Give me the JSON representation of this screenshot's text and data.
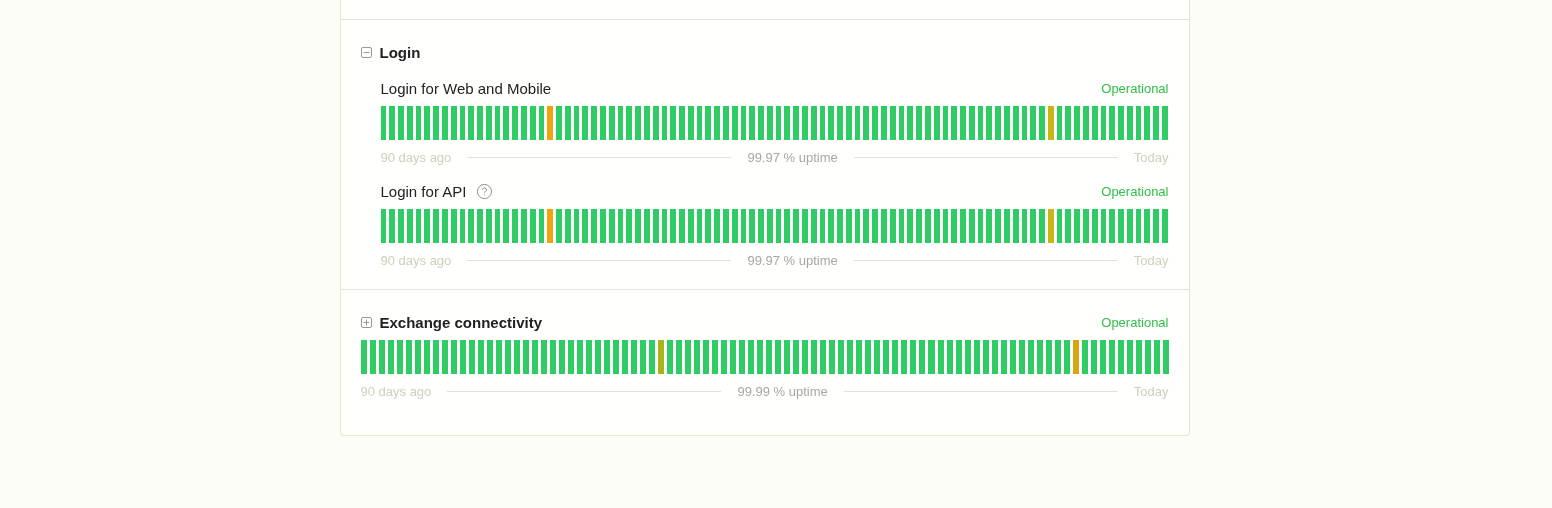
{
  "groups": [
    {
      "name": "Login",
      "expanded": true,
      "components": [
        {
          "name": "Login for Web and Mobile",
          "help": false,
          "status": "Operational",
          "start_label": "90 days ago",
          "uptime": "99.97 % uptime",
          "end_label": "Today",
          "days": [
            {
              "color": "#2fcc66"
            },
            {
              "color": "#2fcc66"
            },
            {
              "color": "#2fcc66"
            },
            {
              "color": "#2fcc66"
            },
            {
              "color": "#2fcc66"
            },
            {
              "color": "#2fcc66"
            },
            {
              "color": "#2fcc66"
            },
            {
              "color": "#2fcc66"
            },
            {
              "color": "#2fcc66"
            },
            {
              "color": "#2fcc66"
            },
            {
              "color": "#2fcc66"
            },
            {
              "color": "#2fcc66"
            },
            {
              "color": "#2fcc66"
            },
            {
              "color": "#2fcc66"
            },
            {
              "color": "#2fcc66"
            },
            {
              "color": "#2fcc66"
            },
            {
              "color": "#2fcc66"
            },
            {
              "color": "#2fcc66"
            },
            {
              "color": "#2fcc66"
            },
            {
              "color": "#f0a30a"
            },
            {
              "color": "#2fcc66"
            },
            {
              "color": "#2fcc66"
            },
            {
              "color": "#2fcc66"
            },
            {
              "color": "#2fcc66"
            },
            {
              "color": "#2fcc66"
            },
            {
              "color": "#2fcc66"
            },
            {
              "color": "#2fcc66"
            },
            {
              "color": "#2fcc66"
            },
            {
              "color": "#2fcc66"
            },
            {
              "color": "#2fcc66"
            },
            {
              "color": "#2fcc66"
            },
            {
              "color": "#2fcc66"
            },
            {
              "color": "#2fcc66"
            },
            {
              "color": "#2fcc66"
            },
            {
              "color": "#2fcc66"
            },
            {
              "color": "#2fcc66"
            },
            {
              "color": "#2fcc66"
            },
            {
              "color": "#2fcc66"
            },
            {
              "color": "#2fcc66"
            },
            {
              "color": "#2fcc66"
            },
            {
              "color": "#2fcc66"
            },
            {
              "color": "#2fcc66"
            },
            {
              "color": "#2fcc66"
            },
            {
              "color": "#2fcc66"
            },
            {
              "color": "#2fcc66"
            },
            {
              "color": "#2fcc66"
            },
            {
              "color": "#2fcc66"
            },
            {
              "color": "#2fcc66"
            },
            {
              "color": "#2fcc66"
            },
            {
              "color": "#2fcc66"
            },
            {
              "color": "#2fcc66"
            },
            {
              "color": "#2fcc66"
            },
            {
              "color": "#2fcc66"
            },
            {
              "color": "#2fcc66"
            },
            {
              "color": "#2fcc66"
            },
            {
              "color": "#2fcc66"
            },
            {
              "color": "#2fcc66"
            },
            {
              "color": "#2fcc66"
            },
            {
              "color": "#2fcc66"
            },
            {
              "color": "#2fcc66"
            },
            {
              "color": "#2fcc66"
            },
            {
              "color": "#2fcc66"
            },
            {
              "color": "#2fcc66"
            },
            {
              "color": "#2fcc66"
            },
            {
              "color": "#2fcc66"
            },
            {
              "color": "#2fcc66"
            },
            {
              "color": "#2fcc66"
            },
            {
              "color": "#2fcc66"
            },
            {
              "color": "#2fcc66"
            },
            {
              "color": "#2fcc66"
            },
            {
              "color": "#2fcc66"
            },
            {
              "color": "#2fcc66"
            },
            {
              "color": "#2fcc66"
            },
            {
              "color": "#2fcc66"
            },
            {
              "color": "#2fcc66"
            },
            {
              "color": "#2fcc66"
            },
            {
              "color": "#c9b516"
            },
            {
              "color": "#2fcc66"
            },
            {
              "color": "#2fcc66"
            },
            {
              "color": "#2fcc66"
            },
            {
              "color": "#2fcc66"
            },
            {
              "color": "#2fcc66"
            },
            {
              "color": "#2fcc66"
            },
            {
              "color": "#2fcc66"
            },
            {
              "color": "#2fcc66"
            },
            {
              "color": "#2fcc66"
            },
            {
              "color": "#2fcc66"
            },
            {
              "color": "#2fcc66"
            },
            {
              "color": "#2fcc66"
            },
            {
              "color": "#2fcc66"
            }
          ]
        },
        {
          "name": "Login for API",
          "help": true,
          "status": "Operational",
          "start_label": "90 days ago",
          "uptime": "99.97 % uptime",
          "end_label": "Today",
          "days": [
            {
              "color": "#2fcc66"
            },
            {
              "color": "#2fcc66"
            },
            {
              "color": "#2fcc66"
            },
            {
              "color": "#2fcc66"
            },
            {
              "color": "#2fcc66"
            },
            {
              "color": "#2fcc66"
            },
            {
              "color": "#2fcc66"
            },
            {
              "color": "#2fcc66"
            },
            {
              "color": "#2fcc66"
            },
            {
              "color": "#2fcc66"
            },
            {
              "color": "#2fcc66"
            },
            {
              "color": "#2fcc66"
            },
            {
              "color": "#2fcc66"
            },
            {
              "color": "#2fcc66"
            },
            {
              "color": "#2fcc66"
            },
            {
              "color": "#2fcc66"
            },
            {
              "color": "#2fcc66"
            },
            {
              "color": "#2fcc66"
            },
            {
              "color": "#2fcc66"
            },
            {
              "color": "#f0a30a"
            },
            {
              "color": "#2fcc66"
            },
            {
              "color": "#2fcc66"
            },
            {
              "color": "#2fcc66"
            },
            {
              "color": "#2fcc66"
            },
            {
              "color": "#2fcc66"
            },
            {
              "color": "#2fcc66"
            },
            {
              "color": "#2fcc66"
            },
            {
              "color": "#2fcc66"
            },
            {
              "color": "#2fcc66"
            },
            {
              "color": "#2fcc66"
            },
            {
              "color": "#2fcc66"
            },
            {
              "color": "#2fcc66"
            },
            {
              "color": "#2fcc66"
            },
            {
              "color": "#2fcc66"
            },
            {
              "color": "#2fcc66"
            },
            {
              "color": "#2fcc66"
            },
            {
              "color": "#2fcc66"
            },
            {
              "color": "#2fcc66"
            },
            {
              "color": "#2fcc66"
            },
            {
              "color": "#2fcc66"
            },
            {
              "color": "#2fcc66"
            },
            {
              "color": "#2fcc66"
            },
            {
              "color": "#2fcc66"
            },
            {
              "color": "#2fcc66"
            },
            {
              "color": "#2fcc66"
            },
            {
              "color": "#2fcc66"
            },
            {
              "color": "#2fcc66"
            },
            {
              "color": "#2fcc66"
            },
            {
              "color": "#2fcc66"
            },
            {
              "color": "#2fcc66"
            },
            {
              "color": "#2fcc66"
            },
            {
              "color": "#2fcc66"
            },
            {
              "color": "#2fcc66"
            },
            {
              "color": "#2fcc66"
            },
            {
              "color": "#2fcc66"
            },
            {
              "color": "#2fcc66"
            },
            {
              "color": "#2fcc66"
            },
            {
              "color": "#2fcc66"
            },
            {
              "color": "#2fcc66"
            },
            {
              "color": "#2fcc66"
            },
            {
              "color": "#2fcc66"
            },
            {
              "color": "#2fcc66"
            },
            {
              "color": "#2fcc66"
            },
            {
              "color": "#2fcc66"
            },
            {
              "color": "#2fcc66"
            },
            {
              "color": "#2fcc66"
            },
            {
              "color": "#2fcc66"
            },
            {
              "color": "#2fcc66"
            },
            {
              "color": "#2fcc66"
            },
            {
              "color": "#2fcc66"
            },
            {
              "color": "#2fcc66"
            },
            {
              "color": "#2fcc66"
            },
            {
              "color": "#2fcc66"
            },
            {
              "color": "#2fcc66"
            },
            {
              "color": "#2fcc66"
            },
            {
              "color": "#2fcc66"
            },
            {
              "color": "#c9b516"
            },
            {
              "color": "#2fcc66"
            },
            {
              "color": "#2fcc66"
            },
            {
              "color": "#2fcc66"
            },
            {
              "color": "#2fcc66"
            },
            {
              "color": "#2fcc66"
            },
            {
              "color": "#2fcc66"
            },
            {
              "color": "#2fcc66"
            },
            {
              "color": "#2fcc66"
            },
            {
              "color": "#2fcc66"
            },
            {
              "color": "#2fcc66"
            },
            {
              "color": "#2fcc66"
            },
            {
              "color": "#2fcc66"
            },
            {
              "color": "#2fcc66"
            }
          ]
        }
      ]
    },
    {
      "name": "Exchange connectivity",
      "expanded": false,
      "status": "Operational",
      "start_label": "90 days ago",
      "uptime": "99.99 % uptime",
      "end_label": "Today",
      "days": [
        {
          "color": "#2fcc66"
        },
        {
          "color": "#2fcc66"
        },
        {
          "color": "#2fcc66"
        },
        {
          "color": "#2fcc66"
        },
        {
          "color": "#2fcc66"
        },
        {
          "color": "#2fcc66"
        },
        {
          "color": "#2fcc66"
        },
        {
          "color": "#2fcc66"
        },
        {
          "color": "#2fcc66"
        },
        {
          "color": "#2fcc66"
        },
        {
          "color": "#2fcc66"
        },
        {
          "color": "#2fcc66"
        },
        {
          "color": "#2fcc66"
        },
        {
          "color": "#2fcc66"
        },
        {
          "color": "#2fcc66"
        },
        {
          "color": "#2fcc66"
        },
        {
          "color": "#2fcc66"
        },
        {
          "color": "#2fcc66"
        },
        {
          "color": "#2fcc66"
        },
        {
          "color": "#2fcc66"
        },
        {
          "color": "#2fcc66"
        },
        {
          "color": "#2fcc66"
        },
        {
          "color": "#2fcc66"
        },
        {
          "color": "#2fcc66"
        },
        {
          "color": "#2fcc66"
        },
        {
          "color": "#2fcc66"
        },
        {
          "color": "#2fcc66"
        },
        {
          "color": "#2fcc66"
        },
        {
          "color": "#2fcc66"
        },
        {
          "color": "#2fcc66"
        },
        {
          "color": "#2fcc66"
        },
        {
          "color": "#2fcc66"
        },
        {
          "color": "#2fcc66"
        },
        {
          "color": "#a8b51a"
        },
        {
          "color": "#2fcc66"
        },
        {
          "color": "#2fcc66"
        },
        {
          "color": "#2fcc66"
        },
        {
          "color": "#2fcc66"
        },
        {
          "color": "#2fcc66"
        },
        {
          "color": "#2fcc66"
        },
        {
          "color": "#2fcc66"
        },
        {
          "color": "#2fcc66"
        },
        {
          "color": "#2fcc66"
        },
        {
          "color": "#2fcc66"
        },
        {
          "color": "#2fcc66"
        },
        {
          "color": "#2fcc66"
        },
        {
          "color": "#2fcc66"
        },
        {
          "color": "#2fcc66"
        },
        {
          "color": "#2fcc66"
        },
        {
          "color": "#2fcc66"
        },
        {
          "color": "#2fcc66"
        },
        {
          "color": "#2fcc66"
        },
        {
          "color": "#2fcc66"
        },
        {
          "color": "#2fcc66"
        },
        {
          "color": "#2fcc66"
        },
        {
          "color": "#2fcc66"
        },
        {
          "color": "#2fcc66"
        },
        {
          "color": "#2fcc66"
        },
        {
          "color": "#2fcc66"
        },
        {
          "color": "#2fcc66"
        },
        {
          "color": "#2fcc66"
        },
        {
          "color": "#2fcc66"
        },
        {
          "color": "#2fcc66"
        },
        {
          "color": "#2fcc66"
        },
        {
          "color": "#2fcc66"
        },
        {
          "color": "#2fcc66"
        },
        {
          "color": "#2fcc66"
        },
        {
          "color": "#2fcc66"
        },
        {
          "color": "#2fcc66"
        },
        {
          "color": "#2fcc66"
        },
        {
          "color": "#2fcc66"
        },
        {
          "color": "#2fcc66"
        },
        {
          "color": "#2fcc66"
        },
        {
          "color": "#2fcc66"
        },
        {
          "color": "#2fcc66"
        },
        {
          "color": "#2fcc66"
        },
        {
          "color": "#2fcc66"
        },
        {
          "color": "#2fcc66"
        },
        {
          "color": "#2fcc66"
        },
        {
          "color": "#d9a514"
        },
        {
          "color": "#2fcc66"
        },
        {
          "color": "#2fcc66"
        },
        {
          "color": "#2fcc66"
        },
        {
          "color": "#2fcc66"
        },
        {
          "color": "#2fcc66"
        },
        {
          "color": "#2fcc66"
        },
        {
          "color": "#2fcc66"
        },
        {
          "color": "#2fcc66"
        },
        {
          "color": "#2fcc66"
        },
        {
          "color": "#2fcc66"
        }
      ]
    }
  ]
}
